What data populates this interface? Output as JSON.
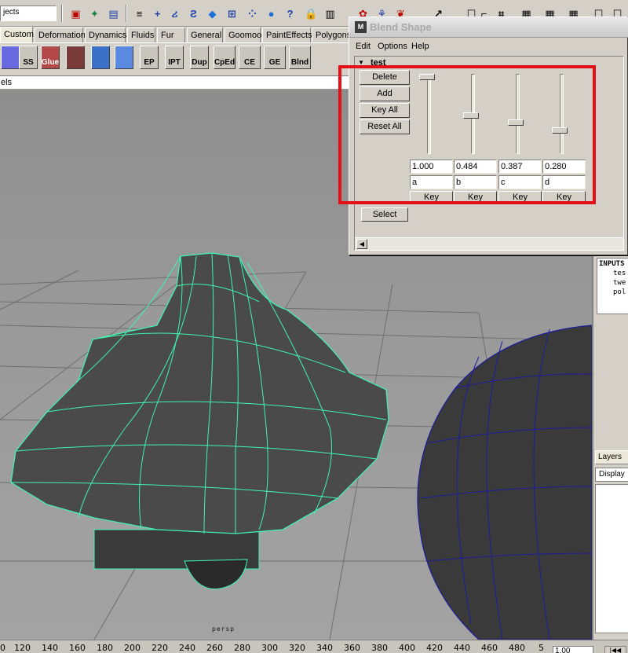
{
  "statusline": {
    "mode_text": "jects"
  },
  "shelf_tabs": [
    {
      "label": "Custom",
      "active": true
    },
    {
      "label": "Deformation",
      "active": false
    },
    {
      "label": "Dynamics",
      "active": false
    },
    {
      "label": "Fluids",
      "active": false
    },
    {
      "label": "Fur",
      "active": false
    },
    {
      "label": "General",
      "active": false
    },
    {
      "label": "Goomoo",
      "active": false
    },
    {
      "label": "PaintEffects",
      "active": false
    },
    {
      "label": "Polygons",
      "active": false
    }
  ],
  "shelf_buttons": [
    "",
    "SS",
    "Glue",
    "",
    "",
    "",
    "EP",
    "IPT",
    "Dup",
    "CpEd",
    "CE",
    "GE",
    "Blnd"
  ],
  "panel_menu": {
    "text": "els"
  },
  "viewport": {
    "camera_label": "persp"
  },
  "blend_shape_window": {
    "title": "Blend Shape",
    "icon_letter": "M",
    "menus": [
      "Edit",
      "Options",
      "Help"
    ],
    "node_name": "test",
    "buttons": {
      "delete": "Delete",
      "add": "Add",
      "key_all": "Key All",
      "reset_all": "Reset All",
      "select": "Select"
    },
    "targets": [
      {
        "name": "a",
        "value": "1.000",
        "weight": 1.0,
        "key_label": "Key"
      },
      {
        "name": "b",
        "value": "0.484",
        "weight": 0.484,
        "key_label": "Key"
      },
      {
        "name": "c",
        "value": "0.387",
        "weight": 0.387,
        "key_label": "Key"
      },
      {
        "name": "d",
        "value": "0.280",
        "weight": 0.28,
        "key_label": "Key"
      }
    ]
  },
  "channel_box": {
    "inputs_lines": [
      "INPUTS",
      "tes",
      "twe",
      "pol"
    ]
  },
  "layers": {
    "tab_label": "Layers",
    "display_label": "Display"
  },
  "time_slider": {
    "ticks": [
      "0",
      "120",
      "140",
      "160",
      "180",
      "200",
      "220",
      "240",
      "260",
      "280",
      "300",
      "320",
      "340",
      "360",
      "380",
      "400",
      "420",
      "440",
      "460",
      "480",
      "5"
    ],
    "current_time": "1.00"
  },
  "colors": {
    "highlight": "#e31017",
    "wire_selected": "#3ff5b4",
    "wire_unselected": "#1c1c9c"
  }
}
